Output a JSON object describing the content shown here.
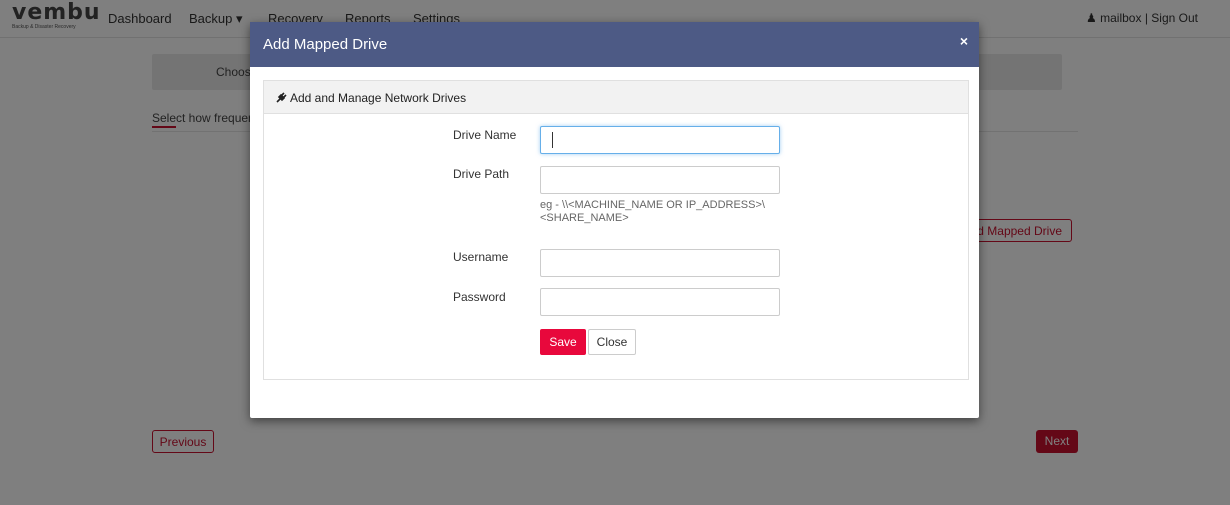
{
  "app": {
    "logo_text": "vembu",
    "logo_tagline": "Backup & Disaster Recovery"
  },
  "nav": {
    "items": [
      {
        "label": "Dashboard"
      },
      {
        "label": "Backup ▾"
      },
      {
        "label": "Recovery"
      },
      {
        "label": "Reports"
      },
      {
        "label": "Settings"
      }
    ],
    "user_icon": "user-icon",
    "user_name": "mailbox",
    "separator": "|",
    "signout": "Sign Out"
  },
  "page": {
    "step_text": "Choos",
    "select_text": "Select how frequent",
    "add_mapped_drive": "d Mapped Drive",
    "previous": "Previous",
    "next": "Next"
  },
  "modal": {
    "title": "Add Mapped Drive",
    "close": "×",
    "panel_title": "Add and Manage Network Drives",
    "panel_icon": "plug-icon",
    "fields": {
      "drive_name": {
        "label": "Drive Name",
        "value": ""
      },
      "drive_path": {
        "label": "Drive Path",
        "value": "",
        "hint": "eg - \\\\<MACHINE_NAME OR IP_ADDRESS>\\<SHARE_NAME>"
      },
      "username": {
        "label": "Username",
        "value": ""
      },
      "password": {
        "label": "Password",
        "value": ""
      }
    },
    "save": "Save",
    "close_label": "Close"
  },
  "colors": {
    "accent": "#c8102e",
    "save": "#e8083c",
    "modal_header": "#4d5a85"
  }
}
